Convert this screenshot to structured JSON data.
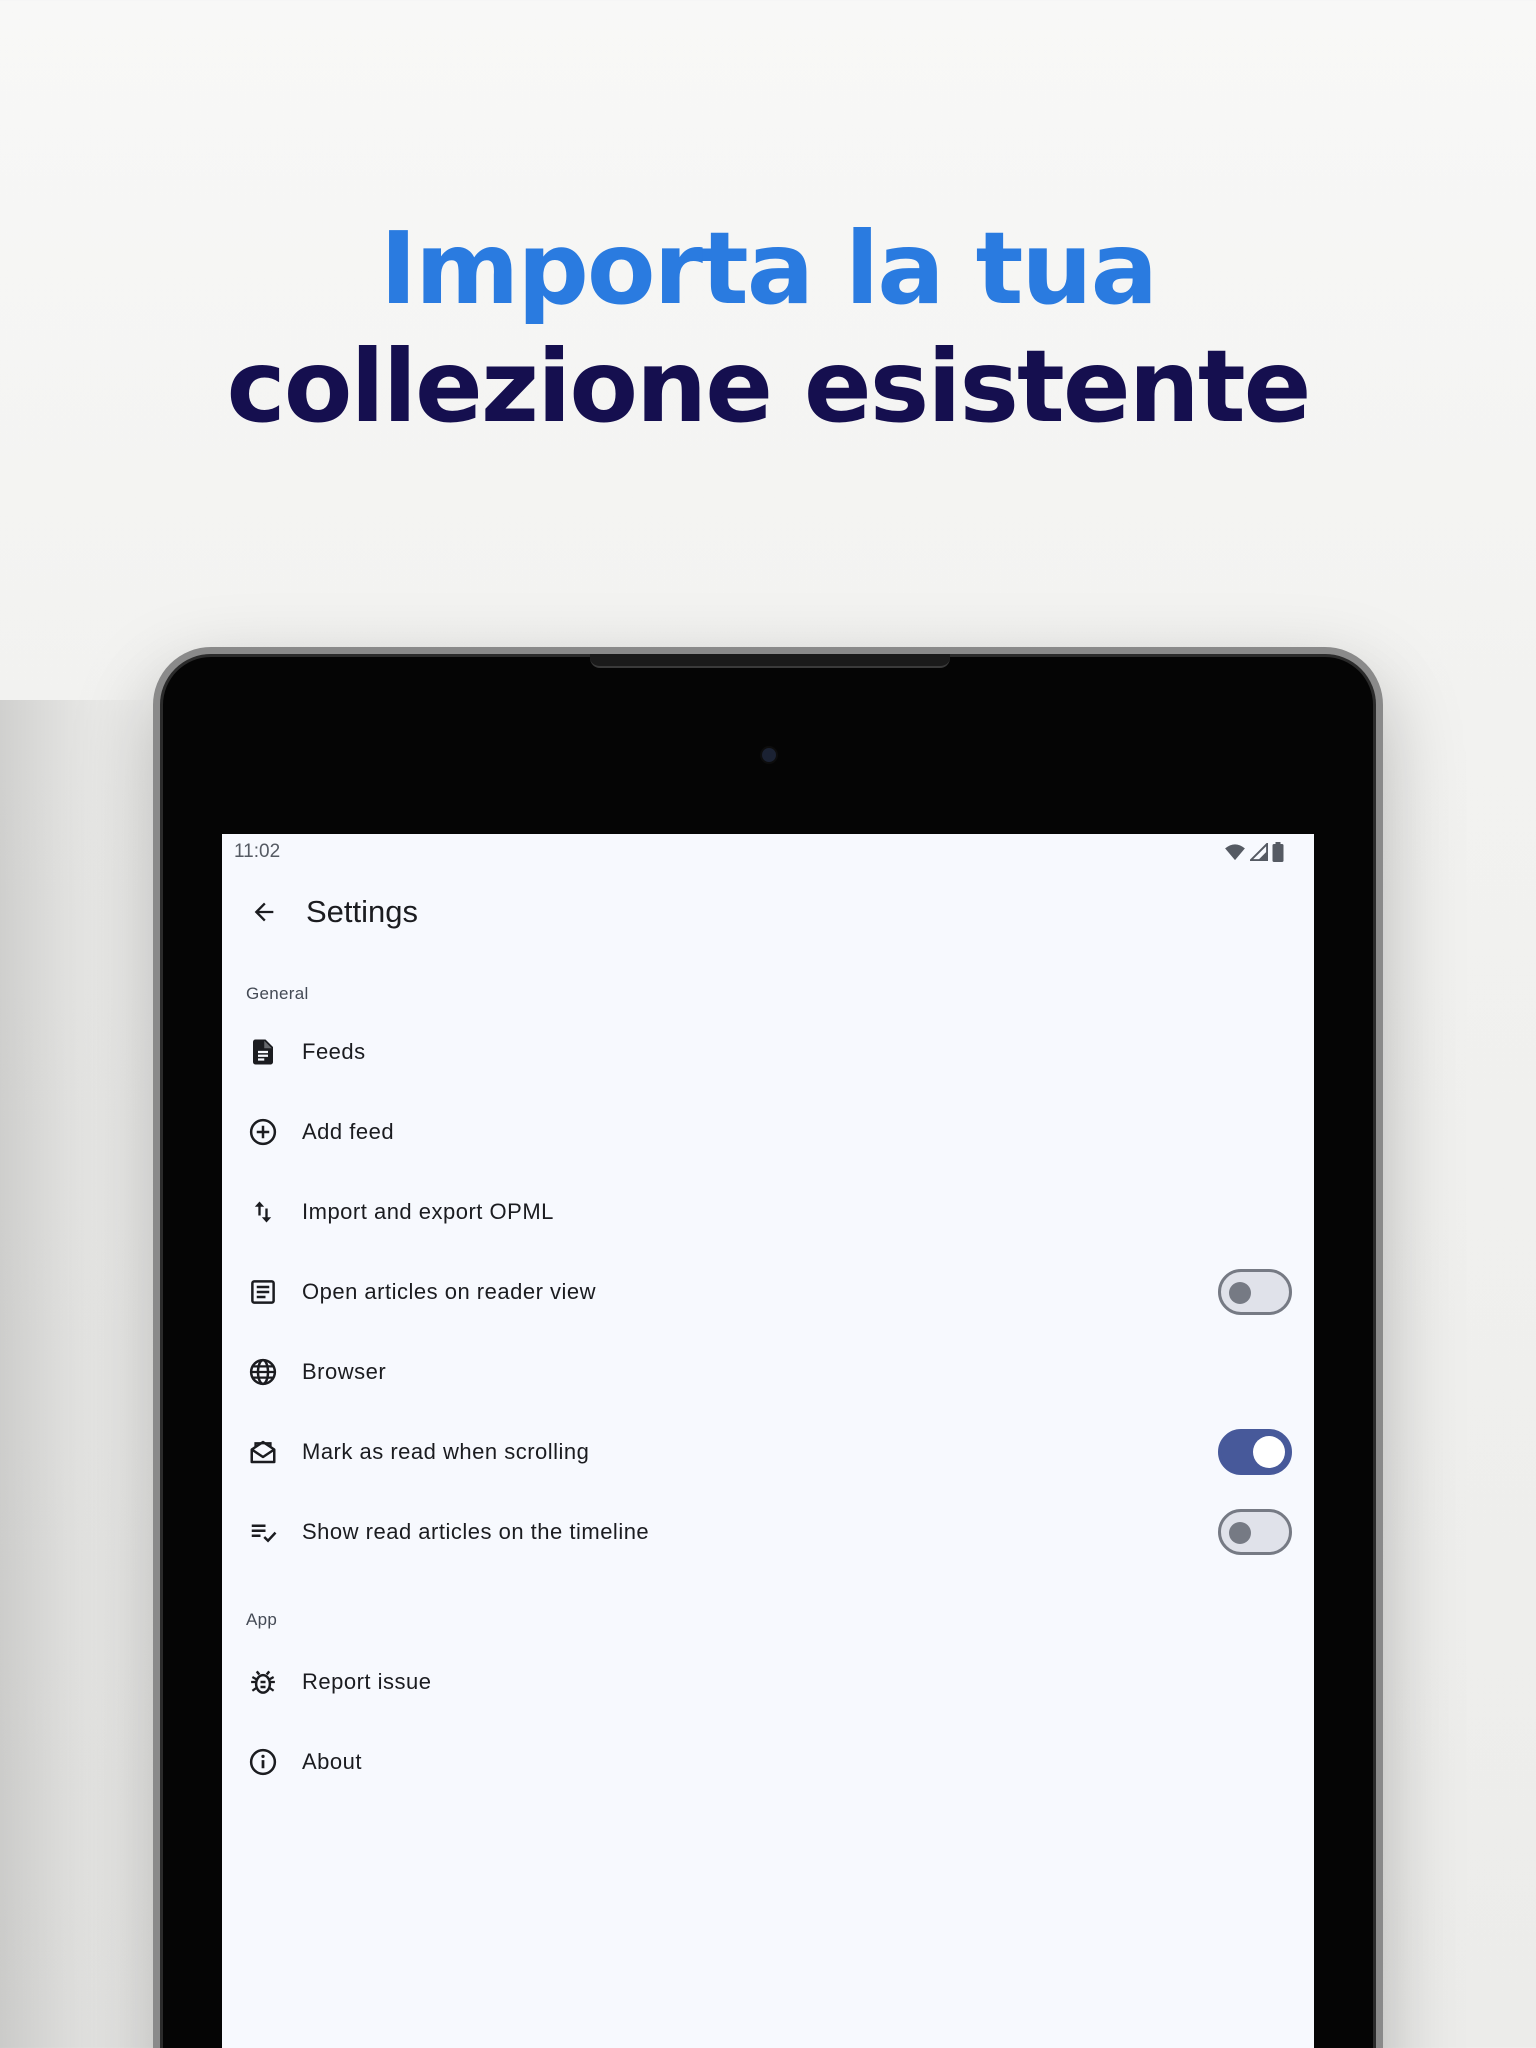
{
  "headline": {
    "line1": "Importa la tua",
    "line2": "collezione esistente",
    "line1_color": "#2a7be0",
    "line2_color": "#150f4f"
  },
  "status_bar": {
    "time": "11:02",
    "icons": [
      "wifi-icon",
      "cell-signal-icon",
      "battery-icon"
    ]
  },
  "app_bar": {
    "title": "Settings",
    "back_icon": "arrow-back-icon"
  },
  "sections": [
    {
      "header": "General",
      "items": [
        {
          "label": "Feeds",
          "icon": "feed-document-icon"
        },
        {
          "label": "Add feed",
          "icon": "add-circle-icon"
        },
        {
          "label": "Import and export OPML",
          "icon": "import-export-icon"
        },
        {
          "label": "Open articles on reader view",
          "icon": "article-icon",
          "switch": false
        },
        {
          "label": "Browser",
          "icon": "globe-icon"
        },
        {
          "label": "Mark as read when scrolling",
          "icon": "mark-read-mail-icon",
          "switch": true
        },
        {
          "label": "Show read articles on the timeline",
          "icon": "playlist-check-icon",
          "switch": false
        }
      ]
    },
    {
      "header": "App",
      "items": [
        {
          "label": "Report issue",
          "icon": "bug-icon"
        },
        {
          "label": "About",
          "icon": "info-icon"
        }
      ]
    }
  ],
  "colors": {
    "switch_on": "#47599a",
    "screen_background": "#f7f9fe",
    "text_primary": "#1b1c20"
  }
}
